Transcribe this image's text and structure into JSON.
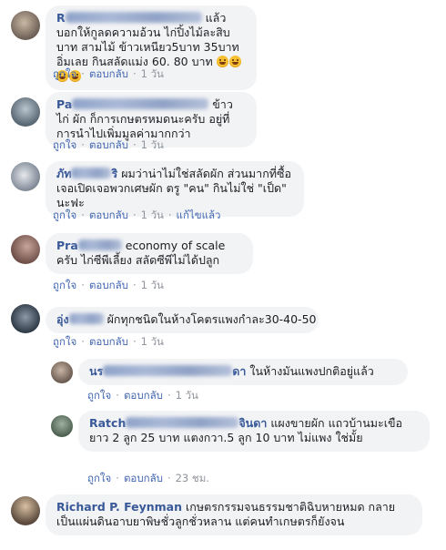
{
  "actions": {
    "like": "ถูกใจ",
    "reply": "ตอบกลับ",
    "sep": "·",
    "edited": "แก้ไขแล้ว"
  },
  "comments": [
    {
      "name_visible": "R",
      "text_after_name": "แล้วบอกให้กูลดความอ้วน ไก่ปิ้งไม้ละสิบบาท สามไม้ ข้าวเหนียว5บาท 35บาทอิ่มเลย กินสลัดแม่ง 60. 80 บาท",
      "emoji_count": 4,
      "time": "1 วัน"
    },
    {
      "name_visible": "Pa",
      "text_after_name": "ข้าว ไก่ ผัก ก็การเกษตรหมดนะครับ อยู่ที่การนำไปเพิ่มมูลค่ามากกว่า",
      "time": "1 วัน"
    },
    {
      "name_visible": "ภัท",
      "name_tail": "ริ",
      "text_after_name": "ผมว่าน่าไม่ใช่สลัดผัก ส่วนมากที่ซื้อเจอเปิดเจอพวกเศษผัก ตรู \"คน\" กินไม่ใช่ \"เป็ด\" นะฟะ",
      "time": "1 วัน",
      "edited": true
    },
    {
      "name_visible": "Pra",
      "text_after_name": "economy of scale ครับ ไก่ซีพีเลี้ยง สลัดซีพีไม่ได้ปลูก",
      "time": "1 วัน"
    },
    {
      "name_visible": "อุ่ง",
      "text_after_name": "ผักทุกชนิดในห้างโคตรแพงกำละ30-40-50",
      "time": "1 วัน"
    },
    {
      "name_visible": "นร",
      "name_tail": "ดา",
      "text_after_name": "ในห้างมันแพงปกติอยู่แล้ว",
      "time": "1 วัน"
    },
    {
      "name_visible": "Ratch",
      "name_tail": "จินดา",
      "text_after_name": "แผงขายผัก แถวบ้านมะเขือยาว 2 ลูก 25 บาท แตงกวา.5 ลูก 10 บาท ไม่แพง ใช่มั้ย",
      "time": "23 ชม."
    },
    {
      "name_visible": "Richard P. Feynman",
      "text_after_name": "เกษตรกรรมจนธรรมชาติฉิบหายหมด กลายเป็นแผ่นดินอาบยาพิษชั่วลูกชั่วหลาน แต่คนทำเกษตรก็ยังจน"
    }
  ]
}
